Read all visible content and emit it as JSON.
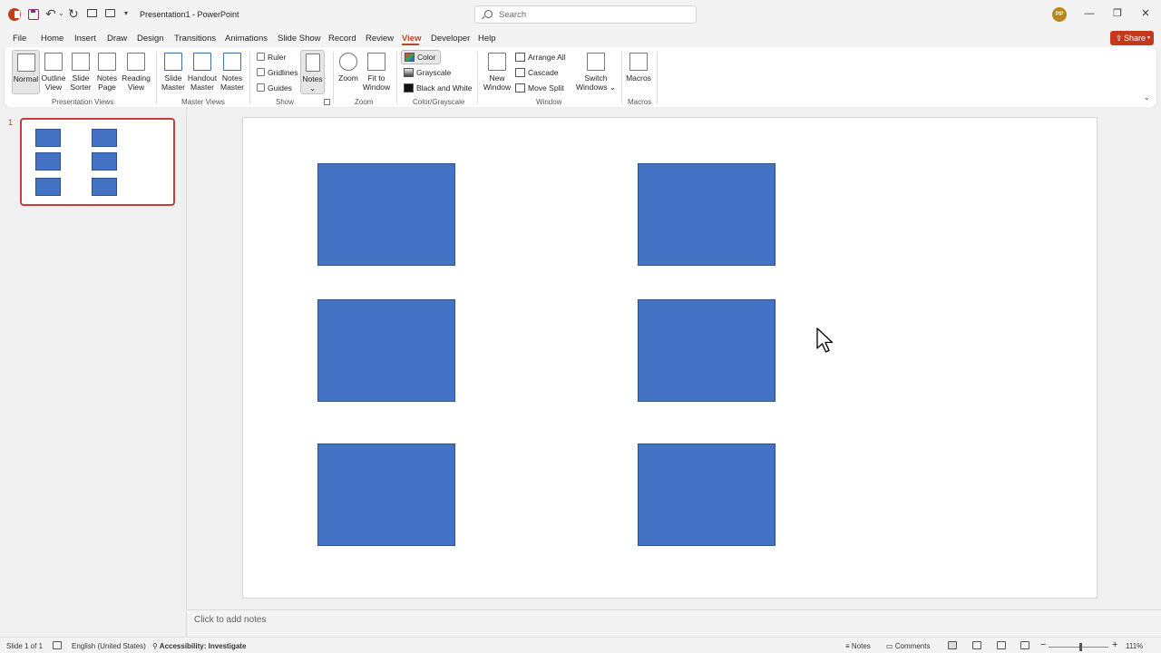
{
  "titlebar": {
    "doc_title": "Presentation1  -  PowerPoint",
    "search_placeholder": "Search",
    "user_initials": "PP",
    "minimize": "—",
    "restore": "❐",
    "close": "✕",
    "qat": {
      "undo": "↶",
      "undo_caret": "⌄",
      "redo": "↻",
      "more": "▾"
    }
  },
  "menu": {
    "tabs": [
      "File",
      "Home",
      "Insert",
      "Draw",
      "Design",
      "Transitions",
      "Animations",
      "Slide Show",
      "Record",
      "Review",
      "View",
      "Developer",
      "Help"
    ],
    "active_tab": "View",
    "share_label": "Share",
    "share_icon": "⇪",
    "share_caret": "▾"
  },
  "ribbon": {
    "presentation_views": {
      "label": "Presentation Views",
      "normal": "Normal",
      "outline_1": "Outline",
      "outline_2": "View",
      "sorter_1": "Slide",
      "sorter_2": "Sorter",
      "notes_page_1": "Notes",
      "notes_page_2": "Page",
      "reading_1": "Reading",
      "reading_2": "View"
    },
    "master_views": {
      "label": "Master Views",
      "slide_1": "Slide",
      "slide_2": "Master",
      "handout_1": "Handout",
      "handout_2": "Master",
      "notes_1": "Notes",
      "notes_2": "Master"
    },
    "show": {
      "label": "Show",
      "ruler": "Ruler",
      "gridlines": "Gridlines",
      "guides": "Guides",
      "notes": "Notes",
      "notes_caret": "⌄"
    },
    "zoom": {
      "label": "Zoom",
      "zoom": "Zoom",
      "fit_1": "Fit to",
      "fit_2": "Window"
    },
    "color_grayscale": {
      "label": "Color/Grayscale",
      "color": "Color",
      "grayscale": "Grayscale",
      "bw": "Black and White"
    },
    "window": {
      "label": "Window",
      "new_1": "New",
      "new_2": "Window",
      "arrange_all": "Arrange All",
      "cascade": "Cascade",
      "move_split": "Move Split",
      "switch_1": "Switch",
      "switch_2": "Windows ⌄"
    },
    "macros": {
      "label": "Macros",
      "macros": "Macros"
    },
    "collapse": "⌄"
  },
  "thumbnails": {
    "slide_number": "1"
  },
  "notes": {
    "placeholder": "Click to add notes"
  },
  "status": {
    "slide_info": "Slide 1 of 1",
    "language": "English (United States)",
    "accessibility": "Accessibility: Investigate",
    "notes": "Notes",
    "comments": "Comments",
    "zoom_minus": "−",
    "zoom_plus": "+",
    "zoom_level": "111%"
  },
  "colors": {
    "accent": "#b7472a",
    "share": "#c4391c",
    "shape_fill": "#4472c4",
    "shape_border": "#2f528f"
  }
}
